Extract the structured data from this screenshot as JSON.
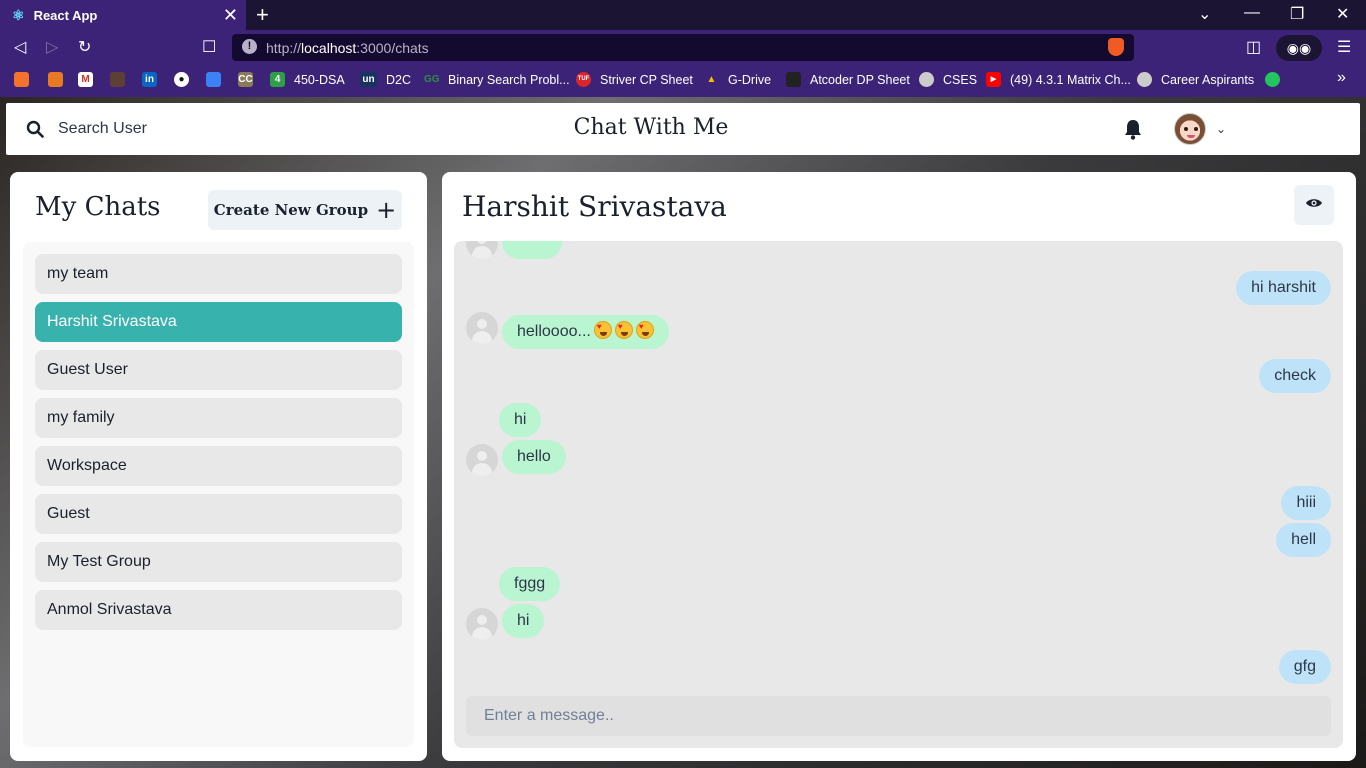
{
  "browser": {
    "tab_title": "React App",
    "url_prefix": "http://",
    "url_host": "localhost",
    "url_path": ":3000/chats",
    "brave_badge": "1"
  },
  "bookmarks": [
    {
      "label": "",
      "icon": "brave-news-icon"
    },
    {
      "label": "",
      "icon": "dsa-icon"
    },
    {
      "label": "",
      "icon": "gmail-icon"
    },
    {
      "label": "",
      "icon": "codechef-icon"
    },
    {
      "label": "",
      "icon": "linkedin-icon"
    },
    {
      "label": "",
      "icon": "github-icon"
    },
    {
      "label": "",
      "icon": "analytics-icon"
    },
    {
      "label": "",
      "icon": "cc-icon"
    },
    {
      "label": "450-DSA",
      "icon": "sheet-icon",
      "icon_text": "4"
    },
    {
      "label": "D2C",
      "icon": "unstop-icon",
      "icon_text": "un"
    },
    {
      "label": "Binary Search Probl...",
      "icon": "gfg-icon",
      "icon_text": "GG"
    },
    {
      "label": "Striver CP Sheet",
      "icon": "tuf-icon",
      "icon_text": "TUF"
    },
    {
      "label": "G-Drive",
      "icon": "drive-icon"
    },
    {
      "label": "Atcoder DP Sheet",
      "icon": "atcoder-icon"
    },
    {
      "label": "CSES",
      "icon": "globe-icon"
    },
    {
      "label": "(49) 4.3.1 Matrix Ch...",
      "icon": "youtube-icon"
    },
    {
      "label": "Career Aspirants",
      "icon": "globe-icon"
    }
  ],
  "header": {
    "search_label": "Search User",
    "brand": "Chat With Me"
  },
  "chats": {
    "title": "My Chats",
    "new_group_label": "Create New Group",
    "items": [
      {
        "label": "my team"
      },
      {
        "label": "Harshit Srivastava",
        "active": true
      },
      {
        "label": "Guest User"
      },
      {
        "label": "my family"
      },
      {
        "label": "Workspace"
      },
      {
        "label": "Guest"
      },
      {
        "label": "My Test Group"
      },
      {
        "label": "Anmol Srivastava"
      }
    ]
  },
  "conversation": {
    "title": "Harshit Srivastava",
    "input_placeholder": "Enter a message..",
    "messages": [
      {
        "text": "",
        "side": "in"
      },
      {
        "text": "hi harshit",
        "side": "out"
      },
      {
        "text": "helloooo...",
        "side": "in",
        "emojis": [
          "star-struck-emoji",
          "star-struck-emoji",
          "star-struck-emoji"
        ]
      },
      {
        "text": "check",
        "side": "out"
      },
      {
        "text": "hi",
        "side": "in"
      },
      {
        "text": "hello",
        "side": "in"
      },
      {
        "text": "hiii",
        "side": "out"
      },
      {
        "text": "hell",
        "side": "out"
      },
      {
        "text": "fggg",
        "side": "in"
      },
      {
        "text": "hi",
        "side": "in"
      },
      {
        "text": "gfg",
        "side": "out"
      }
    ]
  },
  "colors": {
    "active_chat": "#38b2ac",
    "incoming_bubble": "#b9f5d0",
    "outgoing_bubble": "#bee3f8",
    "browser_chrome": "#3d2377"
  }
}
